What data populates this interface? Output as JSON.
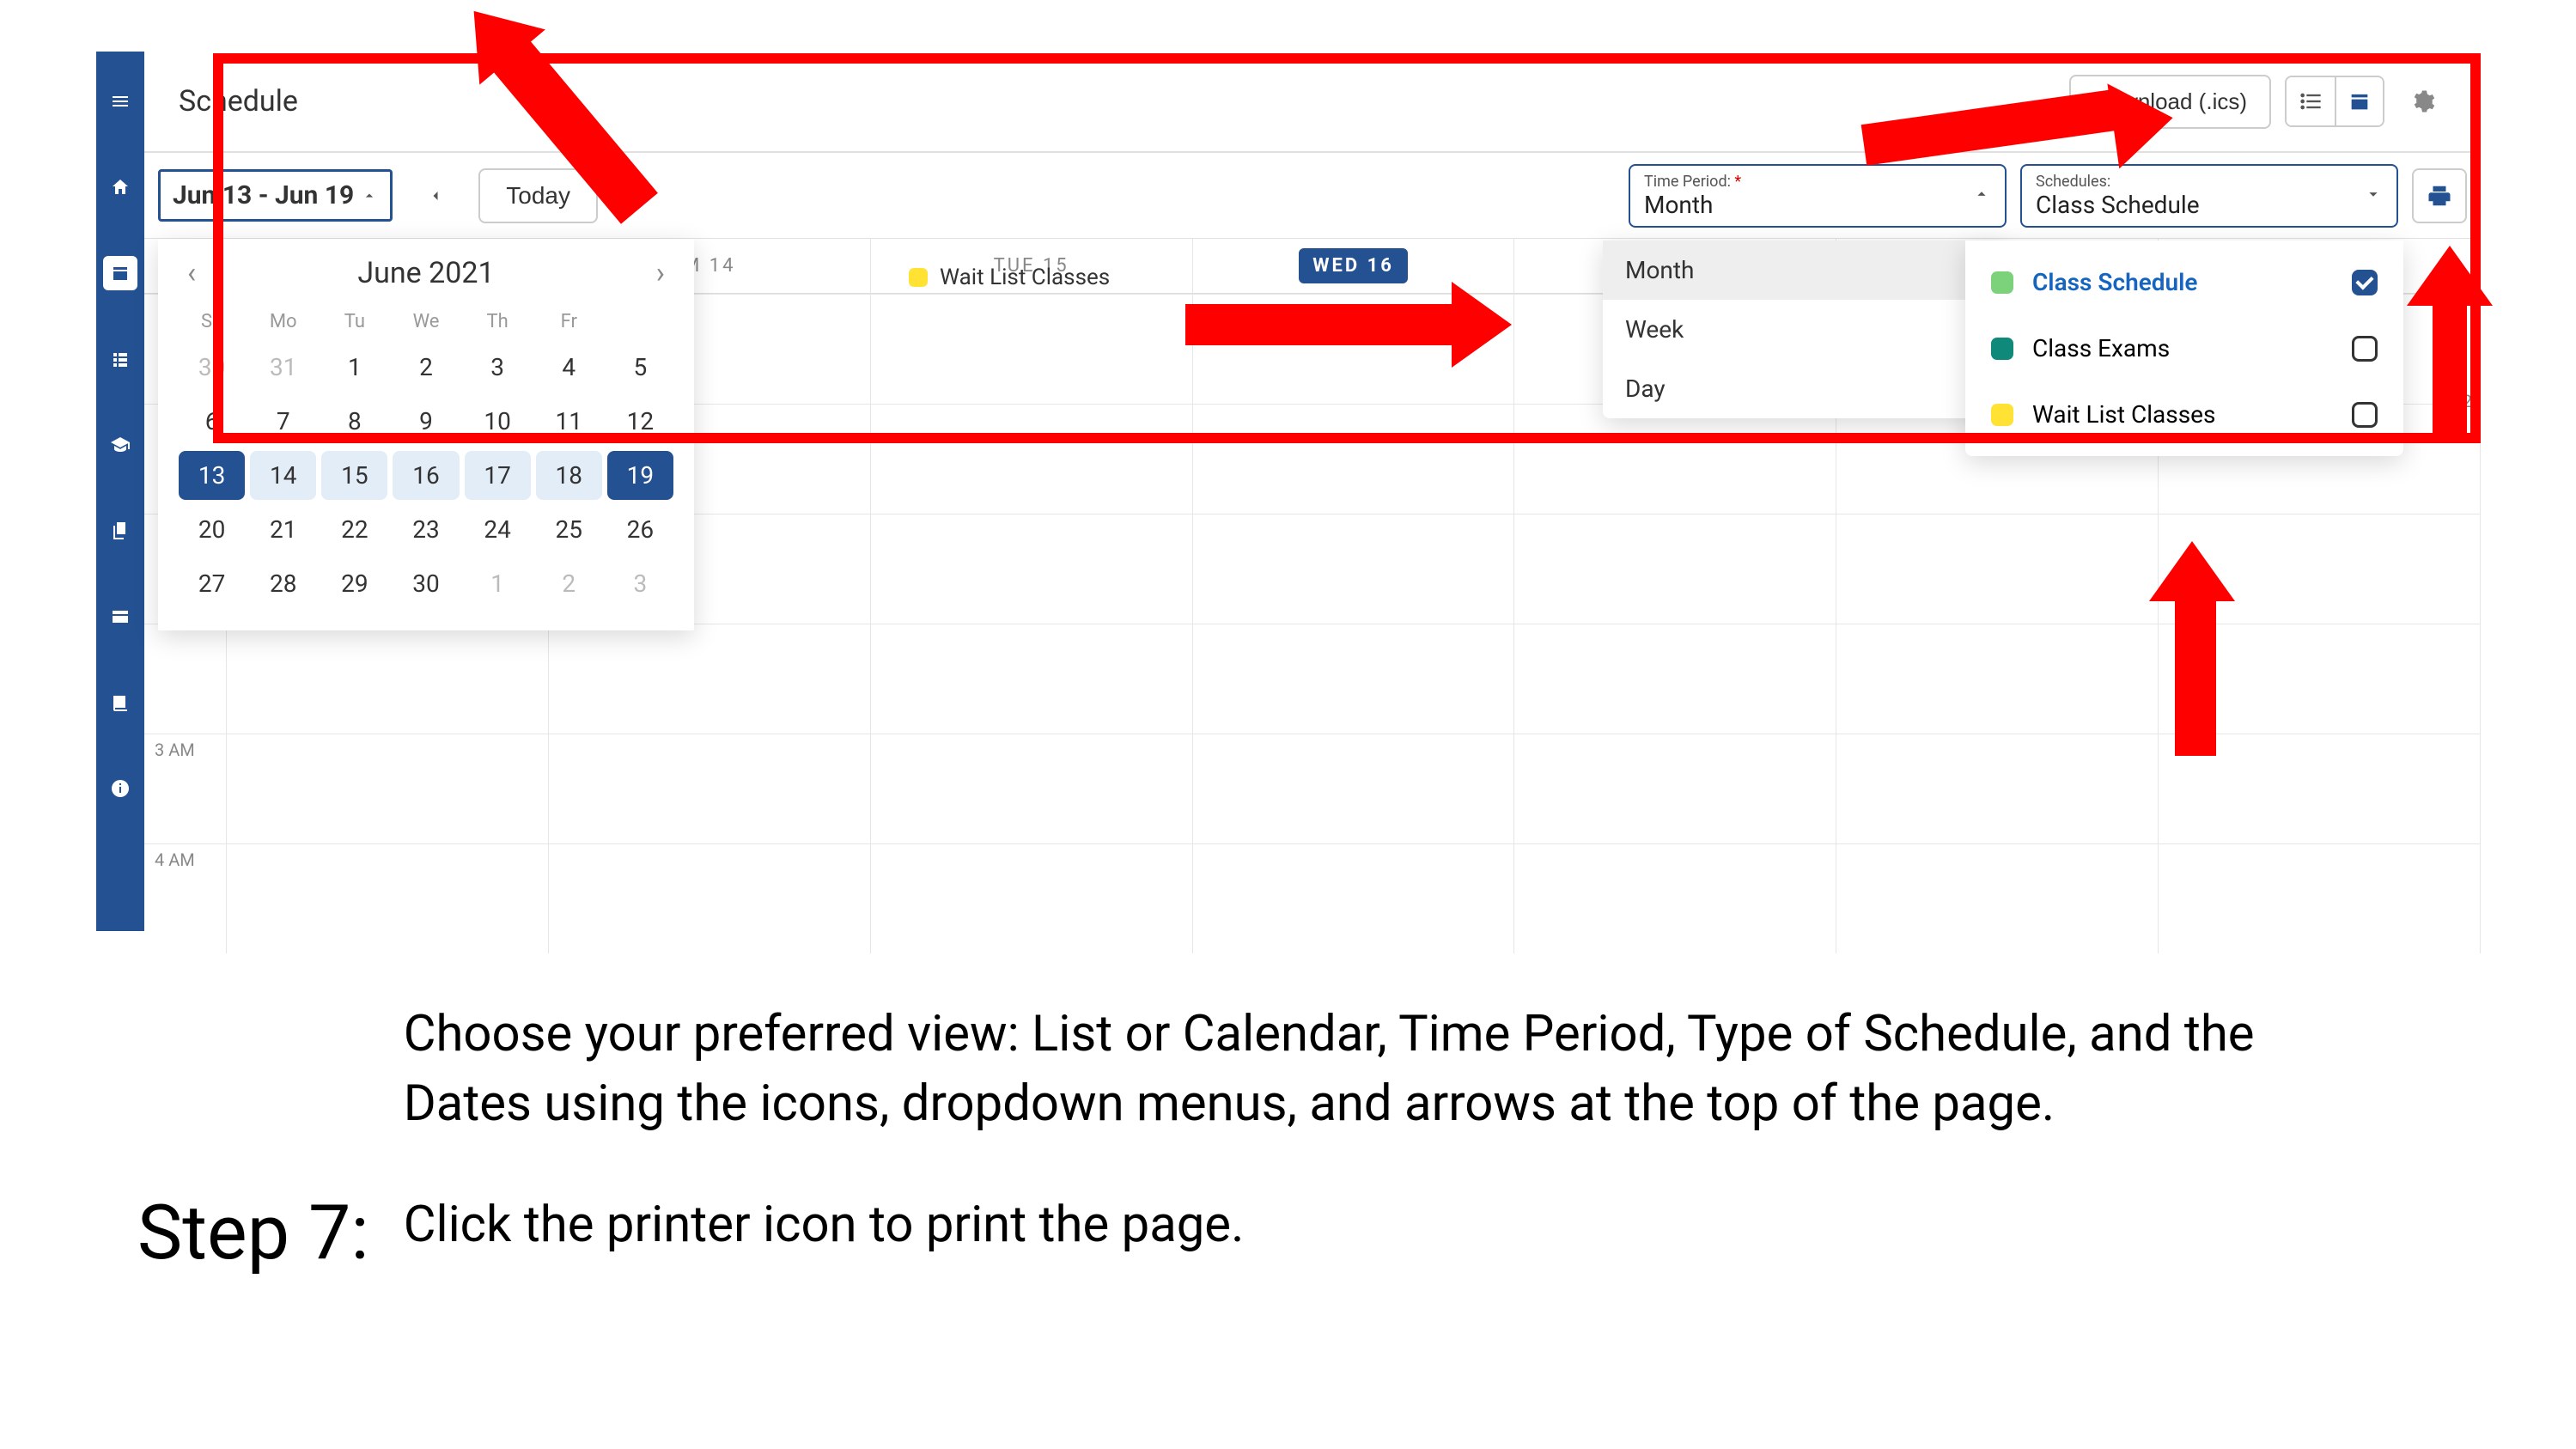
{
  "header": {
    "title": "Schedule",
    "download_label": "Download (.ics)"
  },
  "controls": {
    "date_range": "Jun 13 - Jun 19",
    "today": "Today",
    "time_period": {
      "label": "Time Period:",
      "value": "Month",
      "options": [
        "Month",
        "Week",
        "Day"
      ]
    },
    "schedules": {
      "label": "Schedules:",
      "value": "Class Schedule"
    }
  },
  "legend": {
    "wait_list": "Wait List Classes"
  },
  "week": {
    "days": [
      "M 14",
      "TUE 15",
      "WED 16"
    ],
    "today_index": 2,
    "right_scroll_time": "02",
    "hours": [
      "3 AM",
      "4 AM"
    ]
  },
  "mini_cal": {
    "month_label": "June 2021",
    "dows": [
      "Su",
      "Mo",
      "Tu",
      "We",
      "Th",
      "Fr"
    ],
    "rows": [
      {
        "days": [
          30,
          31,
          1,
          2,
          3,
          4,
          5
        ],
        "prev_count": 2
      },
      {
        "days": [
          6,
          7,
          8,
          9,
          10,
          11,
          12
        ]
      },
      {
        "days": [
          13,
          14,
          15,
          16,
          17,
          18,
          19
        ],
        "range_start": 0,
        "range_end": 6
      },
      {
        "days": [
          20,
          21,
          22,
          23,
          24,
          25,
          26
        ]
      },
      {
        "days": [
          27,
          28,
          29,
          30,
          1,
          2,
          3
        ],
        "next_start": 4
      }
    ]
  },
  "sched_options": [
    {
      "name": "Class Schedule",
      "color": "#7bd27b",
      "checked": true,
      "selected": true
    },
    {
      "name": "Class Exams",
      "color": "#0f8a7a",
      "checked": false
    },
    {
      "name": "Wait List Classes",
      "color": "#ffe234",
      "checked": false
    }
  ],
  "step": {
    "label": "Step 7:",
    "p1": "Choose your preferred view: List or Calendar, Time Period, Type of Schedule, and the Dates using the icons, dropdown menus, and arrows at the top of the page.",
    "p2": "Click the printer icon to print the page."
  }
}
